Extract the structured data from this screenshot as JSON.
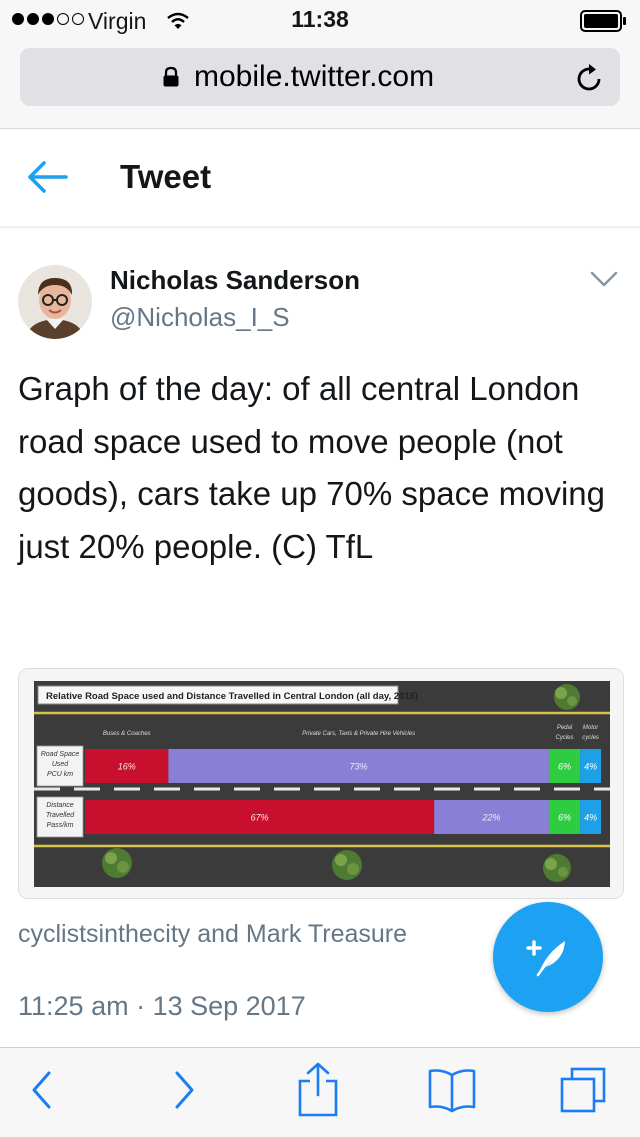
{
  "status_bar": {
    "carrier": "Virgin",
    "time": "11:38"
  },
  "browser": {
    "url": "mobile.twitter.com"
  },
  "header": {
    "title": "Tweet"
  },
  "tweet": {
    "author_name": "Nicholas Sanderson",
    "author_handle": "@Nicholas_I_S",
    "text": "Graph of the day: of all central London road space used to move people (not goods), cars take up 70% space moving just 20% people. (C) TfL",
    "retweeters": "cyclistsinthecity and Mark Treasure",
    "timestamp": "11:25 am · 13 Sep 2017"
  },
  "icons": {
    "wifi": "wifi-icon",
    "battery": "battery-icon",
    "lock": "lock-icon",
    "reload": "reload-icon",
    "back": "back-arrow-icon",
    "more": "chevron-down-icon",
    "compose": "compose-icon",
    "toolbar": [
      "back-icon",
      "forward-icon",
      "share-icon",
      "bookmarks-icon",
      "tabs-icon"
    ]
  },
  "colors": {
    "accent": "#1da1f2",
    "text": "#14171a",
    "muted": "#657786"
  },
  "chart_data": {
    "type": "bar",
    "title": "Relative Road Space used and Distance Travelled in Central London (all day, 2016)",
    "categories": [
      "Buses & Coaches",
      "Private Cars, Taxis & Private Hire Vehicles",
      "Pedal Cycles",
      "Motor cycles"
    ],
    "series": [
      {
        "name": "Road Space Used PCU km",
        "values": [
          16,
          73,
          6,
          4
        ],
        "labels": [
          "16%",
          "73%",
          "6%",
          "4%"
        ]
      },
      {
        "name": "Distance Travelled Pass/km",
        "values": [
          67,
          22,
          6,
          4
        ],
        "labels": [
          "67%",
          "22%",
          "6%",
          "4%"
        ]
      }
    ],
    "colors": [
      "#c8102e",
      "#8a7fd6",
      "#2ecc40",
      "#1ea0e6"
    ]
  }
}
